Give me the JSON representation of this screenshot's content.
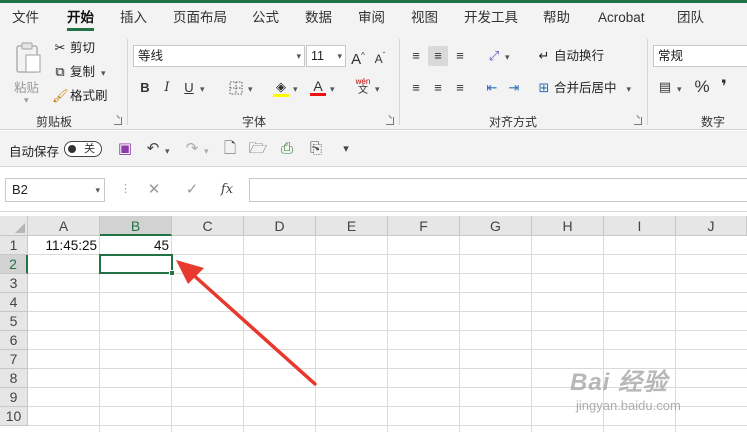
{
  "menu": {
    "tabs": [
      {
        "label": "文件"
      },
      {
        "label": "开始"
      },
      {
        "label": "插入"
      },
      {
        "label": "页面布局"
      },
      {
        "label": "公式"
      },
      {
        "label": "数据"
      },
      {
        "label": "审阅"
      },
      {
        "label": "视图"
      },
      {
        "label": "开发工具"
      },
      {
        "label": "帮助"
      },
      {
        "label": "Acrobat"
      },
      {
        "label": "团队"
      }
    ],
    "active_tab": "开始"
  },
  "ribbon": {
    "clipboard": {
      "group_label": "剪贴板",
      "paste": "粘贴",
      "cut": "剪切",
      "copy": "复制",
      "format_painter": "格式刷"
    },
    "font": {
      "group_label": "字体",
      "font_name": "等线",
      "font_size": "11",
      "bold": "B",
      "italic": "I",
      "underline": "U",
      "grow_font": "A",
      "shrink_font": "A",
      "font_color": "A",
      "phonetic_top": "wén",
      "phonetic_bottom": "文"
    },
    "alignment": {
      "group_label": "对齐方式",
      "wrap_text": "自动换行",
      "merge_center": "合并后居中"
    },
    "number": {
      "group_label": "数字",
      "format": "常规",
      "percent": "%"
    }
  },
  "qat": {
    "autosave_label": "自动保存",
    "autosave_state": "关"
  },
  "formula_bar": {
    "name_box": "B2",
    "fx": "fx",
    "formula": ""
  },
  "sheet": {
    "columns": [
      "A",
      "B",
      "C",
      "D",
      "E",
      "F",
      "G",
      "H",
      "I",
      "J"
    ],
    "rows": [
      "1",
      "2",
      "3",
      "4",
      "5",
      "6",
      "7",
      "8",
      "9",
      "10"
    ],
    "selected_cell": "B2",
    "cells": {
      "A1": "11:45:25",
      "B1": "45"
    }
  },
  "annotation": {
    "arrow_color": "#e8392f",
    "watermark_main": "Bai 经验",
    "watermark_sub": "jingyan.baidu.com"
  },
  "colors": {
    "accent": "#217346"
  }
}
